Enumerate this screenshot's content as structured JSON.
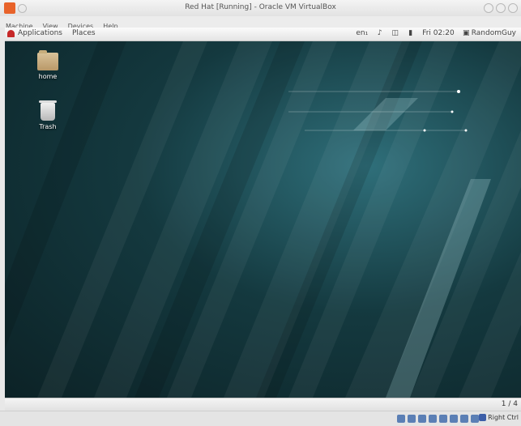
{
  "host_window": {
    "title": "Red Hat [Running] - Oracle VM VirtualBox",
    "menu": [
      "Machine",
      "View",
      "Devices",
      "Help"
    ],
    "status_hotkey": "Right Ctrl"
  },
  "guest_panel": {
    "applications": "Applications",
    "places": "Places",
    "keyboard_layout": "en₁",
    "clock": "Fri 02:20",
    "user": "RandomGuy"
  },
  "desktop_icons": [
    {
      "label": "home",
      "icon": "folder-home-icon"
    },
    {
      "label": "Trash",
      "icon": "trash-icon"
    }
  ],
  "workspace_indicator": "1 / 4",
  "colors": {
    "desktop_dark": "#0c2226",
    "desktop_light": "#2f6f7a",
    "virtualbox_orange": "#e8632a",
    "redhat_red": "#c62828"
  }
}
